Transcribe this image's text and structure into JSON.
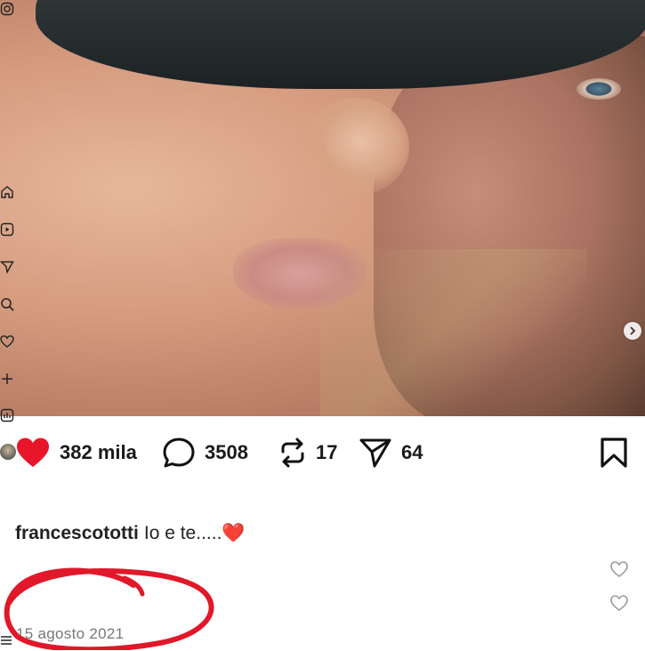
{
  "post": {
    "likes": "382 mila",
    "comments": "3508",
    "reposts": "17",
    "shares": "64",
    "username": "francescototti",
    "caption_text": "Io e te.....",
    "caption_emoji": "❤️",
    "date": "15 agosto 2021"
  },
  "icons": {
    "rail": [
      "instagram-icon",
      "home-icon",
      "reels-icon",
      "send-icon",
      "search-icon",
      "heart-icon",
      "plus-icon",
      "stats-icon"
    ],
    "actions": [
      "heart-filled-icon",
      "comment-icon",
      "repost-icon",
      "share-icon",
      "bookmark-icon"
    ]
  },
  "colors": {
    "like_red": "#e8162a",
    "annotation_red": "#e0182a",
    "text_dark": "#1a1a1a",
    "date_gray": "#777777"
  }
}
